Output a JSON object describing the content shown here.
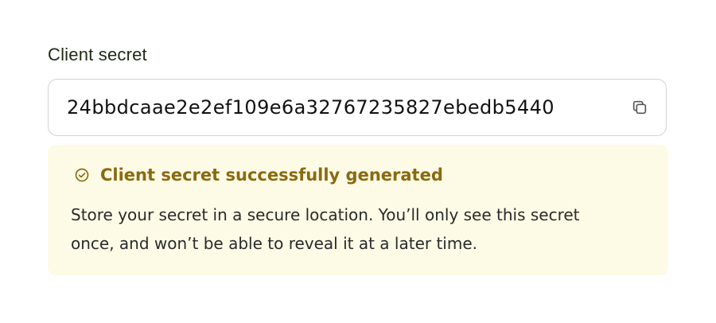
{
  "field": {
    "label": "Client secret",
    "value": "24bbdcaae2e2ef109e6a32767235827ebedb5440"
  },
  "icons": {
    "copy": "copy-icon",
    "success": "check-circle-icon"
  },
  "notice": {
    "title": "Client secret successfully generated",
    "body": "Store your secret in a secure location. You’ll only see this secret once, and won’t be able to reveal it at a later time."
  },
  "colors": {
    "notice_background": "#fdfbe6",
    "notice_accent": "#8a6a10",
    "field_border": "#d3d3d3"
  }
}
